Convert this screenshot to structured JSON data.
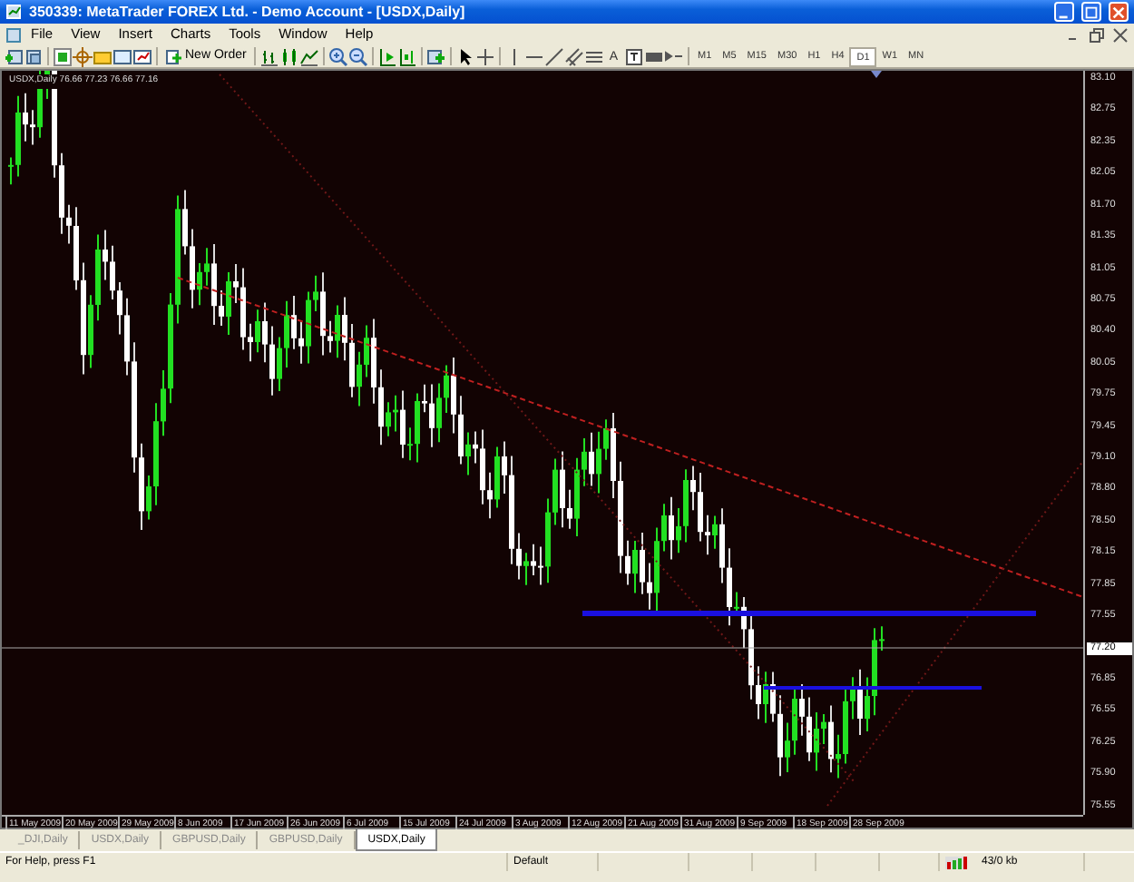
{
  "window": {
    "title": "350339: MetaTrader FOREX Ltd. - Demo Account - [USDX,Daily]"
  },
  "menu": [
    "File",
    "View",
    "Insert",
    "Charts",
    "Tools",
    "Window",
    "Help"
  ],
  "toolbar": {
    "new_order": "New Order",
    "text_tools": [
      "A"
    ],
    "timeframes": [
      {
        "label": "M1",
        "selected": false
      },
      {
        "label": "M5",
        "selected": false
      },
      {
        "label": "M15",
        "selected": false
      },
      {
        "label": "M30",
        "selected": false
      },
      {
        "label": "H1",
        "selected": false
      },
      {
        "label": "H4",
        "selected": false
      },
      {
        "label": "D1",
        "selected": true
      },
      {
        "label": "W1",
        "selected": false
      },
      {
        "label": "MN",
        "selected": false
      }
    ]
  },
  "chart": {
    "label": "USDX,Daily 76.66 77.23 76.66 77.16",
    "price_axis": [
      {
        "text": "83.10",
        "current": false
      },
      {
        "text": "82.75",
        "current": false
      },
      {
        "text": "82.35",
        "current": false
      },
      {
        "text": "82.05",
        "current": false
      },
      {
        "text": "81.70",
        "current": false
      },
      {
        "text": "81.35",
        "current": false
      },
      {
        "text": "81.05",
        "current": false
      },
      {
        "text": "80.75",
        "current": false
      },
      {
        "text": "80.40",
        "current": false
      },
      {
        "text": "80.05",
        "current": false
      },
      {
        "text": "79.75",
        "current": false
      },
      {
        "text": "79.45",
        "current": false
      },
      {
        "text": "79.10",
        "current": false
      },
      {
        "text": "78.80",
        "current": false
      },
      {
        "text": "78.50",
        "current": false
      },
      {
        "text": "78.15",
        "current": false
      },
      {
        "text": "77.85",
        "current": false
      },
      {
        "text": "77.55",
        "current": false
      },
      {
        "text": "77.20",
        "current": true
      },
      {
        "text": "76.85",
        "current": false
      },
      {
        "text": "76.55",
        "current": false
      },
      {
        "text": "76.25",
        "current": false
      },
      {
        "text": "75.90",
        "current": false
      },
      {
        "text": "75.55",
        "current": false
      }
    ],
    "time_axis": [
      "11 May 2009",
      "20 May 2009",
      "29 May 2009",
      "8 Jun 2009",
      "17 Jun 2009",
      "26 Jun 2009",
      "6 Jul 2009",
      "15 Jul 2009",
      "24 Jul 2009",
      "3 Aug 2009",
      "12 Aug 2009",
      "21 Aug 2009",
      "31 Aug 2009",
      "9 Sep 2009",
      "18 Sep 2009",
      "28 Sep 2009"
    ]
  },
  "tabs": [
    {
      "label": "_DJI,Daily",
      "selected": false
    },
    {
      "label": "USDX,Daily",
      "selected": false
    },
    {
      "label": "GBPUSD,Daily",
      "selected": false
    },
    {
      "label": "GBPUSD,Daily",
      "selected": false
    },
    {
      "label": "USDX,Daily",
      "selected": true
    }
  ],
  "status_bar": {
    "help": "For Help, press F1",
    "profile": "Default",
    "traffic": "43/0 kb"
  }
}
